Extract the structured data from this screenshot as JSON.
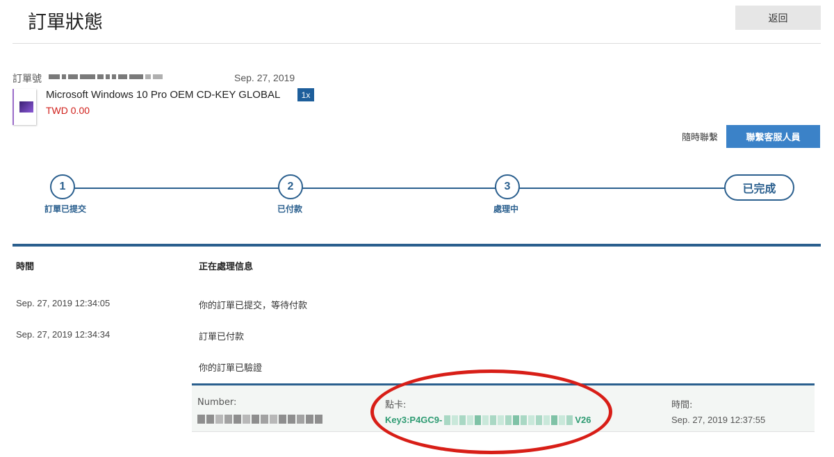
{
  "header": {
    "title": "訂單狀態",
    "back_label": "返回"
  },
  "order": {
    "number_label": "訂單號",
    "date": "Sep. 27, 2019",
    "product_name": "Microsoft Windows 10 Pro OEM CD-KEY GLOBAL",
    "quantity": "1x",
    "price": "TWD 0.00",
    "thumbnail_icon": "windows-box-icon"
  },
  "contact": {
    "label": "隨時聯繫",
    "button_label": "聯繫客服人員"
  },
  "progress": {
    "steps": [
      {
        "number": "1",
        "label": "訂單已提交"
      },
      {
        "number": "2",
        "label": "已付款"
      },
      {
        "number": "3",
        "label": "處理中"
      }
    ],
    "final_label": "已完成"
  },
  "log": {
    "time_header": "時間",
    "info_header": "正在處理信息",
    "entries": [
      {
        "time": "Sep. 27, 2019 12:34:05",
        "message": "你的訂單已提交，等待付款"
      },
      {
        "time": "Sep. 27, 2019 12:34:34",
        "message": "訂單已付款"
      },
      {
        "time": "",
        "message": "你的訂單已驗證"
      }
    ]
  },
  "key_panel": {
    "number_label": "Number:",
    "card_label": "點卡:",
    "card_key_prefix": "Key3:P4GC9-",
    "card_key_suffix": "V26",
    "time_label": "時間:",
    "time_value": "Sep. 27, 2019 12:37:55"
  },
  "colors": {
    "accent": "#2a5f8e",
    "button_blue": "#3b82c8",
    "price_red": "#d0201b",
    "key_green": "#2e9b72",
    "annotation_red": "#d81e17"
  }
}
